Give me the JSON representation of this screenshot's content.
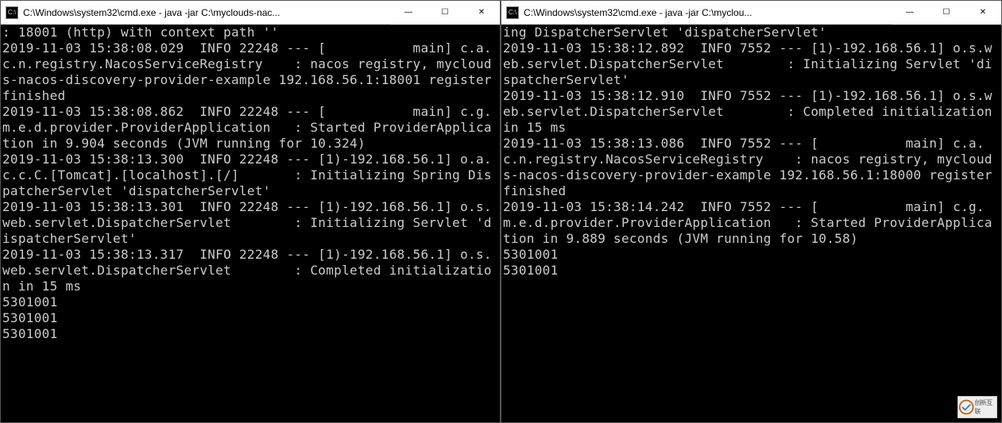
{
  "leftWindow": {
    "title": "C:\\Windows\\system32\\cmd.exe - java  -jar C:\\myclouds-nac...",
    "console": ": 18001 (http) with context path ''\n2019-11-03 15:38:08.029  INFO 22248 --- [           main] c.a.c.n.registry.NacosServiceRegistry    : nacos registry, myclouds-nacos-discovery-provider-example 192.168.56.1:18001 register finished\n2019-11-03 15:38:08.862  INFO 22248 --- [           main] c.g.m.e.d.provider.ProviderApplication   : Started ProviderApplication in 9.904 seconds (JVM running for 10.324)\n2019-11-03 15:38:13.300  INFO 22248 --- [1)-192.168.56.1] o.a.c.c.C.[Tomcat].[localhost].[/]       : Initializing Spring DispatcherServlet 'dispatcherServlet'\n2019-11-03 15:38:13.301  INFO 22248 --- [1)-192.168.56.1] o.s.web.servlet.DispatcherServlet        : Initializing Servlet 'dispatcherServlet'\n2019-11-03 15:38:13.317  INFO 22248 --- [1)-192.168.56.1] o.s.web.servlet.DispatcherServlet        : Completed initialization in 15 ms\n5301001\n5301001\n5301001"
  },
  "rightWindow": {
    "title": "C:\\Windows\\system32\\cmd.exe - java  -jar C:\\myclou...",
    "console": "ing DispatcherServlet 'dispatcherServlet'\n2019-11-03 15:38:12.892  INFO 7552 --- [1)-192.168.56.1] o.s.web.servlet.DispatcherServlet        : Initializing Servlet 'dispatcherServlet'\n2019-11-03 15:38:12.910  INFO 7552 --- [1)-192.168.56.1] o.s.web.servlet.DispatcherServlet        : Completed initialization in 15 ms\n2019-11-03 15:38:13.086  INFO 7552 --- [           main] c.a.c.n.registry.NacosServiceRegistry    : nacos registry, myclouds-nacos-discovery-provider-example 192.168.56.1:18000 register finished\n2019-11-03 15:38:14.242  INFO 7552 --- [           main] c.g.m.e.d.provider.ProviderApplication   : Started ProviderApplication in 9.889 seconds (JVM running for 10.58)\n5301001\n5301001"
  },
  "controls": {
    "minimize": "—",
    "maximize": "☐",
    "close": "✕"
  },
  "watermark": {
    "text": "创新互联"
  }
}
